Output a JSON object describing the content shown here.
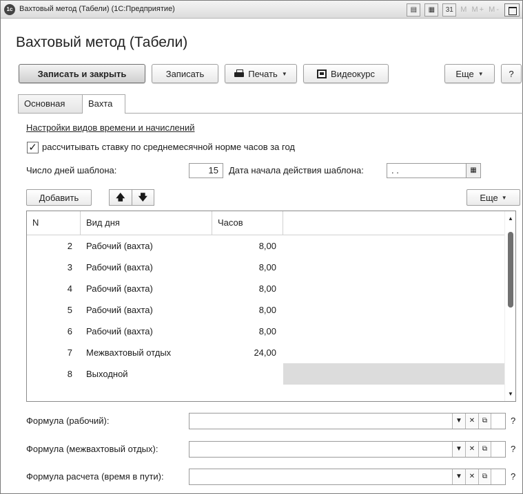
{
  "window": {
    "title": "Вахтовый метод (Табели)  (1С:Предприятие)",
    "app_icon": "1c",
    "mem_buttons": "M  M+  M-"
  },
  "page": {
    "heading": "Вахтовый метод (Табели)"
  },
  "toolbar": {
    "save_close": "Записать и закрыть",
    "save": "Записать",
    "print": "Печать",
    "video": "Видеокурс",
    "more": "Еще",
    "help": "?"
  },
  "tabs": [
    {
      "label": "Основная",
      "active": false
    },
    {
      "label": "Вахта",
      "active": true
    }
  ],
  "settings_link": "Настройки видов времени и начислений",
  "checkbox": {
    "label": "рассчитывать ставку по среднемесячной норме часов за год",
    "checked": true,
    "mark": "✓"
  },
  "template": {
    "days_label": "Число дней шаблона:",
    "days_value": "15",
    "start_label": "Дата начала действия шаблона:",
    "start_value": " .  ."
  },
  "table_toolbar": {
    "add": "Добавить",
    "up": "🡅",
    "down": "🡇",
    "more": "Еще"
  },
  "table": {
    "columns": [
      "N",
      "Вид дня",
      "Часов"
    ],
    "rows": [
      {
        "n": "2",
        "type": "Рабочий (вахта)",
        "hours": "8,00"
      },
      {
        "n": "3",
        "type": "Рабочий (вахта)",
        "hours": "8,00"
      },
      {
        "n": "4",
        "type": "Рабочий (вахта)",
        "hours": "8,00"
      },
      {
        "n": "5",
        "type": "Рабочий (вахта)",
        "hours": "8,00"
      },
      {
        "n": "6",
        "type": "Рабочий (вахта)",
        "hours": "8,00"
      },
      {
        "n": "7",
        "type": "Межвахтовый отдых",
        "hours": "24,00"
      },
      {
        "n": "8",
        "type": "Выходной",
        "hours": ""
      }
    ]
  },
  "formulas": [
    {
      "label": "Формула (рабочий):",
      "value": ""
    },
    {
      "label": "Формула (межвахтовый отдых):",
      "value": ""
    },
    {
      "label": "Формула расчета (время в пути):",
      "value": ""
    }
  ],
  "colors": {
    "selection": "#dcdcdc",
    "border": "#9a9a9a",
    "text": "#1a1a1a"
  }
}
